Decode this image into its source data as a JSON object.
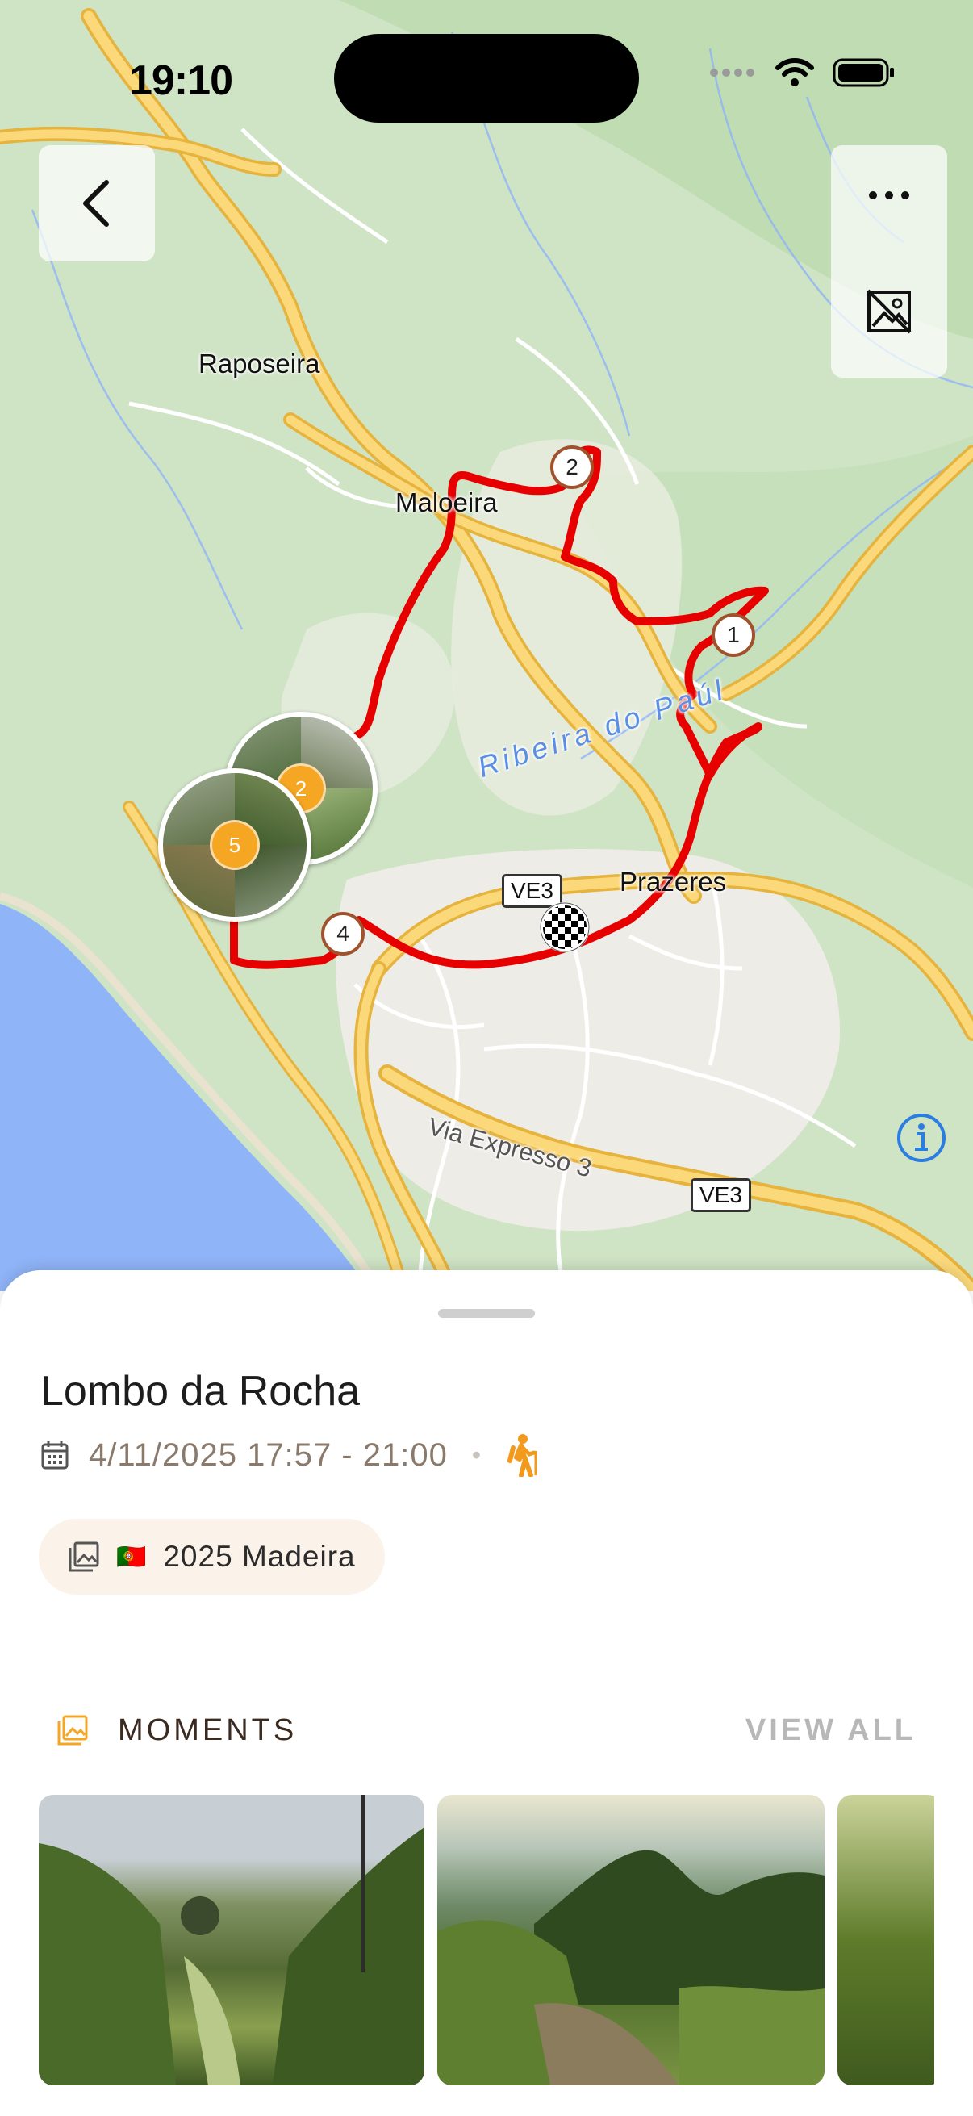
{
  "status_bar": {
    "time": "19:10"
  },
  "map": {
    "labels": {
      "raposeira": "Raposeira",
      "maloeira": "Maloeira",
      "prazeres": "Prazeres",
      "ribeira": "Ribeira do Paúl",
      "via_expresso": "Via Expresso 3"
    },
    "road_shields": {
      "ve3_a": "VE3",
      "ve3_b": "VE3"
    },
    "waypoints": {
      "w1": "1",
      "w2": "2",
      "w4": "4"
    },
    "photo_clusters": {
      "c1": "2",
      "c2": "5"
    },
    "route_color": "#e60000"
  },
  "track": {
    "title": "Lombo da Rocha",
    "date_range": "4/11/2025 17:57 - 21:00",
    "separator": "•",
    "activity_icon": "hiking-icon",
    "collection": {
      "flag": "🇵🇹",
      "label": "2025 Madeira"
    }
  },
  "moments": {
    "header": "MOMENTS",
    "view_all": "VIEW ALL"
  },
  "colors": {
    "accent": "#f5a623",
    "sheet_chip": "#fbf2ea"
  }
}
